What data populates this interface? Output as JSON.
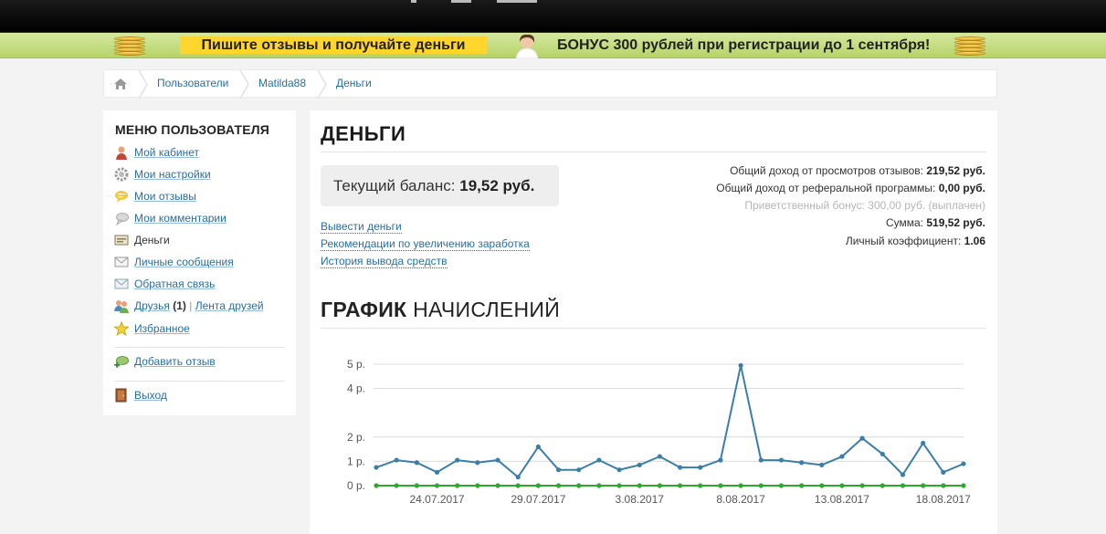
{
  "promo": {
    "left_text": "Пишите отзывы и получайте деньги",
    "right_text": "БОНУС 300 рублей при регистрации до 1 сентября!"
  },
  "breadcrumb": {
    "home_icon": "home-icon",
    "items": [
      "Пользователи",
      "Matilda88",
      "Деньги"
    ]
  },
  "sidebar": {
    "title": "МЕНЮ ПОЛЬЗОВАТЕЛЯ",
    "items": [
      {
        "label": "Мой кабинет",
        "icon": "user-icon"
      },
      {
        "label": "Мои настройки",
        "icon": "gear-icon"
      },
      {
        "label": "Мои отзывы",
        "icon": "review-icon"
      },
      {
        "label": "Мои комментарии",
        "icon": "comment-icon"
      },
      {
        "label": "Деньги",
        "icon": "money-icon"
      },
      {
        "label": "Личные сообщения",
        "icon": "mail-icon"
      },
      {
        "label": "Обратная связь",
        "icon": "feedback-icon"
      },
      {
        "label": "Друзья",
        "count": "(1)",
        "separator": "|",
        "extra": "Лента друзей",
        "icon": "friends-icon"
      },
      {
        "label": "Избранное",
        "icon": "star-icon"
      }
    ],
    "add_review": {
      "label": "Добавить отзыв",
      "icon": "add-review-icon"
    },
    "logout": {
      "label": "Выход",
      "icon": "exit-door-icon"
    }
  },
  "main": {
    "title": "ДЕНЬГИ",
    "balance_label": "Текущий баланс:",
    "balance_value": "19,52 руб.",
    "links": [
      "Вывести деньги",
      "Рекомендации по увеличению заработка",
      "История вывода средств"
    ],
    "stats": [
      {
        "label": "Общий доход от просмотров отзывов:",
        "value": "219,52 руб."
      },
      {
        "label": "Общий доход от реферальной программы:",
        "value": "0,00 руб."
      },
      {
        "label": "Приветственный бонус:",
        "value": "300,00 руб.",
        "note": "(выплачен)"
      },
      {
        "label": "Сумма:",
        "value": "519,52 руб."
      },
      {
        "label": "Личный коэффициент:",
        "value": "1.06"
      }
    ],
    "chart_title_bold": "ГРАФИК",
    "chart_title_rest": "НАЧИСЛЕНИЙ"
  },
  "chart_data": {
    "type": "line",
    "x": [
      "21.07.2017",
      "22.07.2017",
      "23.07.2017",
      "24.07.2017",
      "25.07.2017",
      "26.07.2017",
      "27.07.2017",
      "28.07.2017",
      "29.07.2017",
      "30.07.2017",
      "31.07.2017",
      "1.08.2017",
      "2.08.2017",
      "3.08.2017",
      "4.08.2017",
      "5.08.2017",
      "6.08.2017",
      "7.08.2017",
      "8.08.2017",
      "9.08.2017",
      "10.08.2017",
      "11.08.2017",
      "12.08.2017",
      "13.08.2017",
      "14.08.2017",
      "15.08.2017",
      "16.08.2017",
      "17.08.2017",
      "18.08.2017",
      "19.08.2017"
    ],
    "x_tick_labels": [
      "24.07.2017",
      "29.07.2017",
      "3.08.2017",
      "8.08.2017",
      "13.08.2017",
      "18.08.2017"
    ],
    "y_ticks": [
      0,
      1,
      2,
      4,
      5
    ],
    "y_tick_labels": [
      "0 р.",
      "1 р.",
      "2 р.",
      "4 р.",
      "5 р."
    ],
    "ylim": [
      0,
      5
    ],
    "series": [
      {
        "color": "#3c7ea6",
        "values": [
          0.75,
          1.05,
          0.95,
          0.55,
          1.05,
          0.95,
          1.05,
          0.35,
          1.6,
          0.65,
          0.65,
          1.05,
          0.65,
          0.85,
          1.2,
          0.75,
          0.75,
          1.05,
          4.95,
          1.05,
          1.05,
          0.95,
          0.85,
          1.2,
          1.95,
          1.3,
          0.45,
          1.75,
          0.55,
          0.9
        ]
      },
      {
        "color": "#2fa82f",
        "values": [
          0,
          0,
          0,
          0,
          0,
          0,
          0,
          0,
          0,
          0,
          0,
          0,
          0,
          0,
          0,
          0,
          0,
          0,
          0,
          0,
          0,
          0,
          0,
          0,
          0,
          0,
          0,
          0,
          0,
          0
        ]
      }
    ],
    "grid": true
  }
}
